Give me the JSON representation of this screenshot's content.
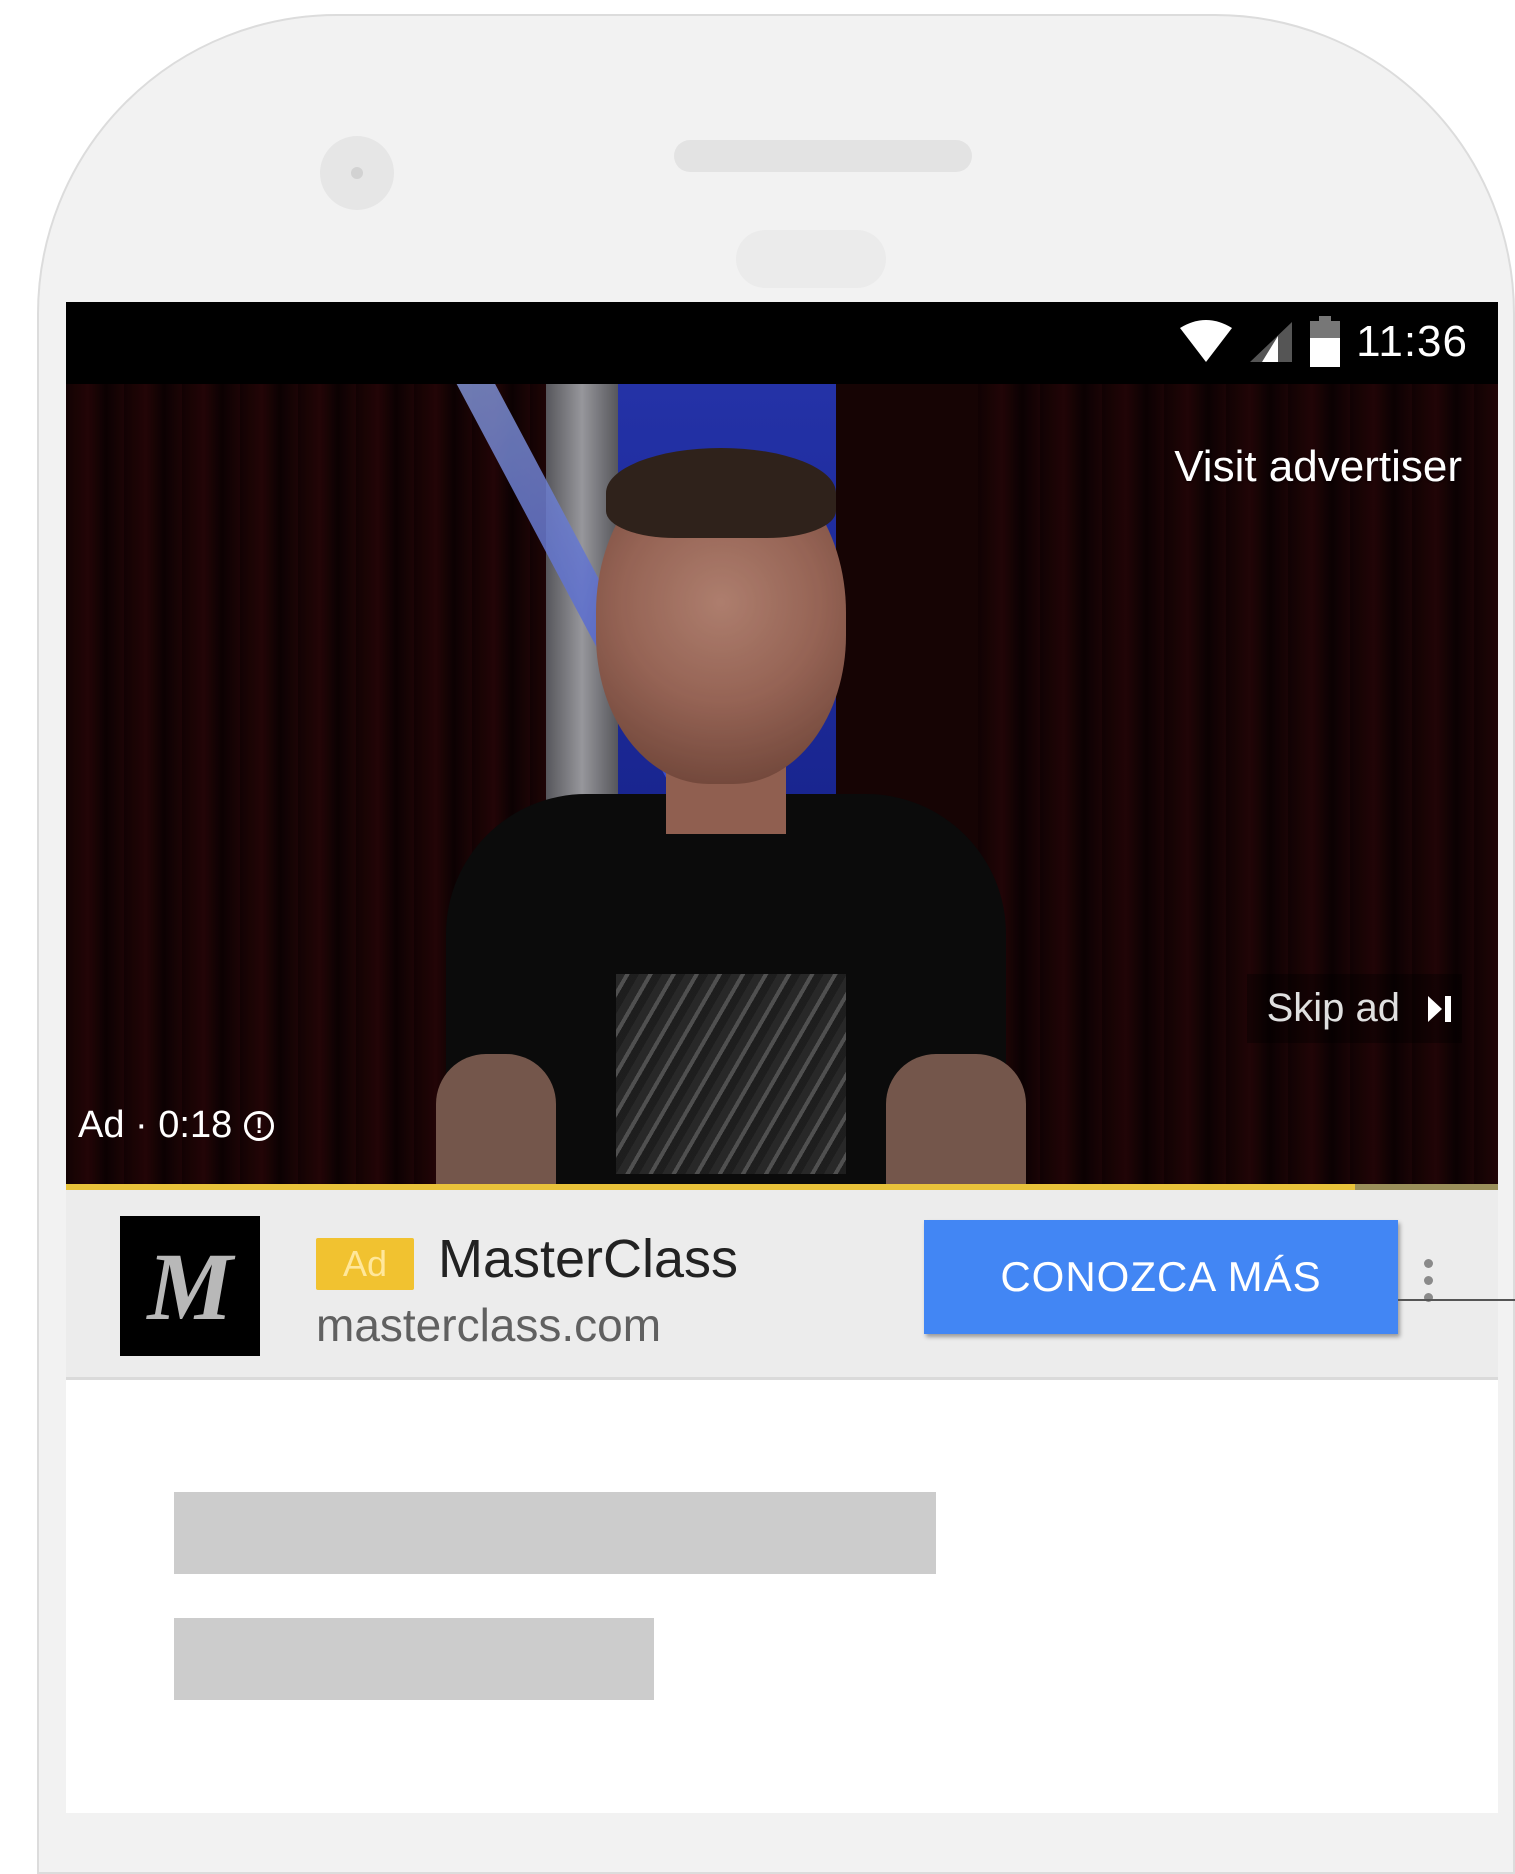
{
  "status_bar": {
    "time": "11:36",
    "icons": [
      "wifi-icon",
      "cellular-signal-icon",
      "battery-icon"
    ]
  },
  "video": {
    "visit_advertiser_label": "Visit advertiser",
    "skip_ad_label": "Skip ad",
    "ad_timer_label": "Ad · 0:18",
    "progress_fraction": 0.9
  },
  "ad_bar": {
    "logo_letter": "M",
    "badge_label": "Ad",
    "advertiser_name": "MasterClass",
    "advertiser_url": "masterclass.com",
    "cta_label": "CONOZCA MÁS"
  },
  "colors": {
    "cta_blue": "#4286f4",
    "ad_badge_yellow": "#f1c230",
    "progress_yellow": "#e8c23a",
    "status_bar_black": "#000000"
  }
}
